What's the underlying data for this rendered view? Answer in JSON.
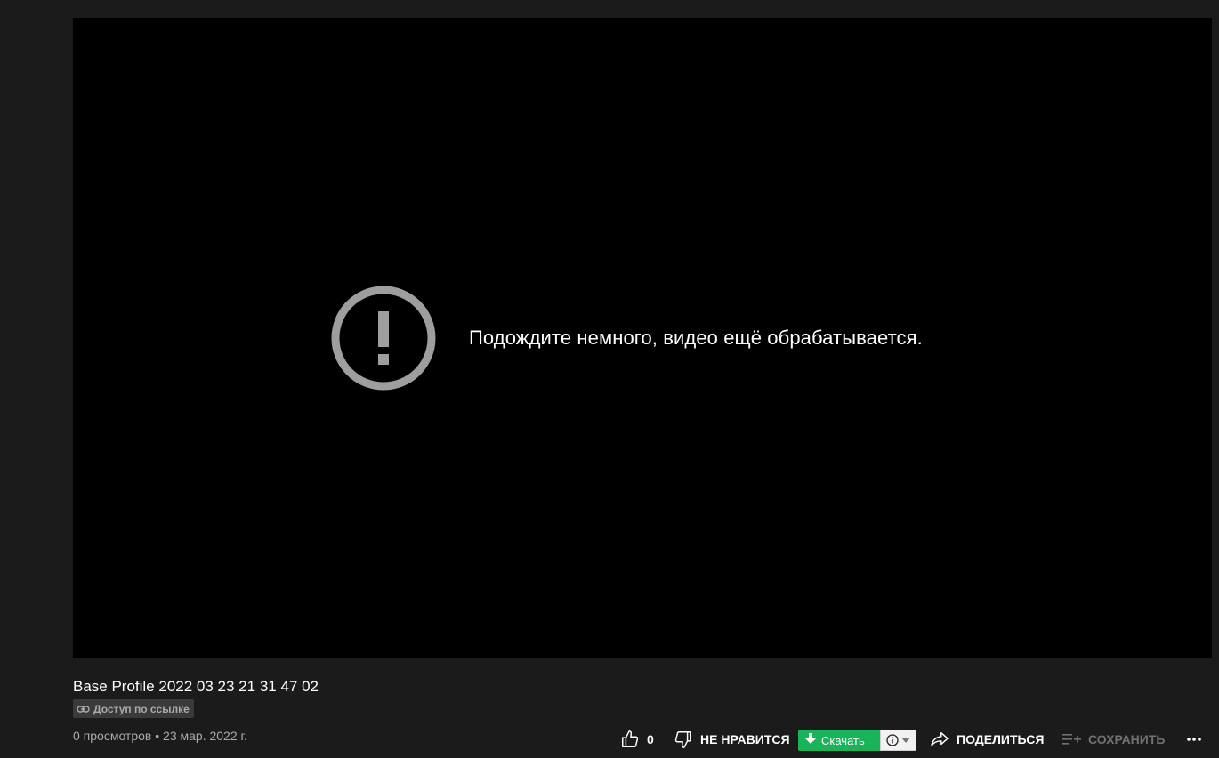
{
  "player": {
    "message": "Подождите немного, видео ещё обрабатывается.",
    "icon": "alert-circle-icon"
  },
  "video": {
    "title": "Base Profile 2022 03 23 21 31 47 02",
    "privacy_badge": "Доступ по ссылке",
    "views": "0 просмотров",
    "separator": "•",
    "date": "23 мар. 2022 г."
  },
  "actions": {
    "like_count": "0",
    "dislike_label": "НЕ НРАВИТСЯ",
    "download_label": "Скачать",
    "share_label": "ПОДЕЛИТЬСЯ",
    "save_label": "СОХРАНИТЬ"
  },
  "colors": {
    "background": "#1b1b1b",
    "player": "#000000",
    "download_green": "#19b35a",
    "muted_text": "#aaaaaa"
  }
}
